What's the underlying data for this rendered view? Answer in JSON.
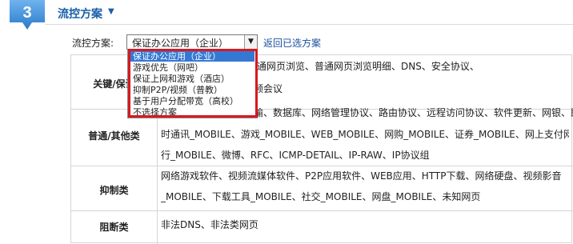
{
  "header": {
    "step": "3",
    "title": "流控方案",
    "caret": "▼"
  },
  "strategy": {
    "label": "流控方案:",
    "selected": "保证办公应用（企业）",
    "arrow": "▼",
    "back_link": "返回已选方案",
    "options": [
      "保证办公应用（企业）",
      "游戏优先（网吧）",
      "保证上网和游戏（酒店）",
      "抑制P2P/视频（普教）",
      "基于用户分配带宽（高校）",
      "不选择方案"
    ]
  },
  "table": {
    "rows": [
      {
        "category": "关键/保证",
        "lines": [
          "话、电子邮件协议、普通网页浏览、普通网页浏览明细、DNS、安全协议、",
          "频会议"
        ]
      },
      {
        "category": "普通/其他类",
        "lines": [
          "输、数据库、网络管理协议、路由协议、远程访问协议、软件更新、网银、即",
          "时通讯_MOBILE、游戏_MOBILE、WEB_MOBILE、网购_MOBILE、证券_MOBILE、网上支付网上银",
          "行_MOBILE、微博、RFC、ICMP-DETAIL、IP-RAW、IP协议组"
        ]
      },
      {
        "category": "抑制类",
        "lines": [
          "网络游戏软件、视频流媒体软件、P2P应用软件、WEB应用、HTTP下载、网络硬盘、视频影音",
          "_MOBILE、下载工具_MOBILE、社交_MOBILE、网盘_MOBILE、未知网页"
        ]
      },
      {
        "category": "阻断类",
        "lines": [
          "非法DNS、非法类网页"
        ]
      }
    ]
  },
  "colors": {
    "accent": "#1a5fa8",
    "highlight_border": "#d71920",
    "selection_bg": "#3478d4"
  }
}
